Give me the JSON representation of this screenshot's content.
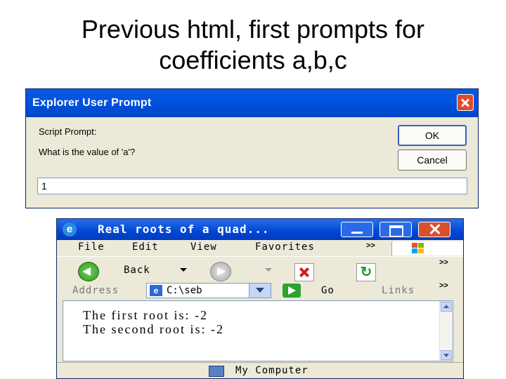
{
  "slide": {
    "title_line1": "Previous html, first prompts for",
    "title_line2": "coefficients a,b,c"
  },
  "prompt_dialog": {
    "title": "Explorer User Prompt",
    "label_script": "Script Prompt:",
    "label_question": "What is the value of 'a'?",
    "ok_label": "OK",
    "cancel_label": "Cancel",
    "input_value": "1"
  },
  "ie_window": {
    "title": "Real roots of a quad...",
    "menu": [
      "File",
      "Edit",
      "View",
      "Favorites"
    ],
    "toolbar": {
      "back_label": "Back"
    },
    "address": {
      "label": "Address",
      "value": "C:\\seb",
      "go_label": "Go",
      "links_label": "Links"
    },
    "content_lines": [
      "The first root is: -2",
      "The second root is: -2"
    ],
    "status": "My Computer",
    "chevron": ">>"
  },
  "colors": {
    "xp_blue": "#0053e0",
    "dialog_bg": "#ece9d8",
    "close_red": "#e04a2a"
  }
}
